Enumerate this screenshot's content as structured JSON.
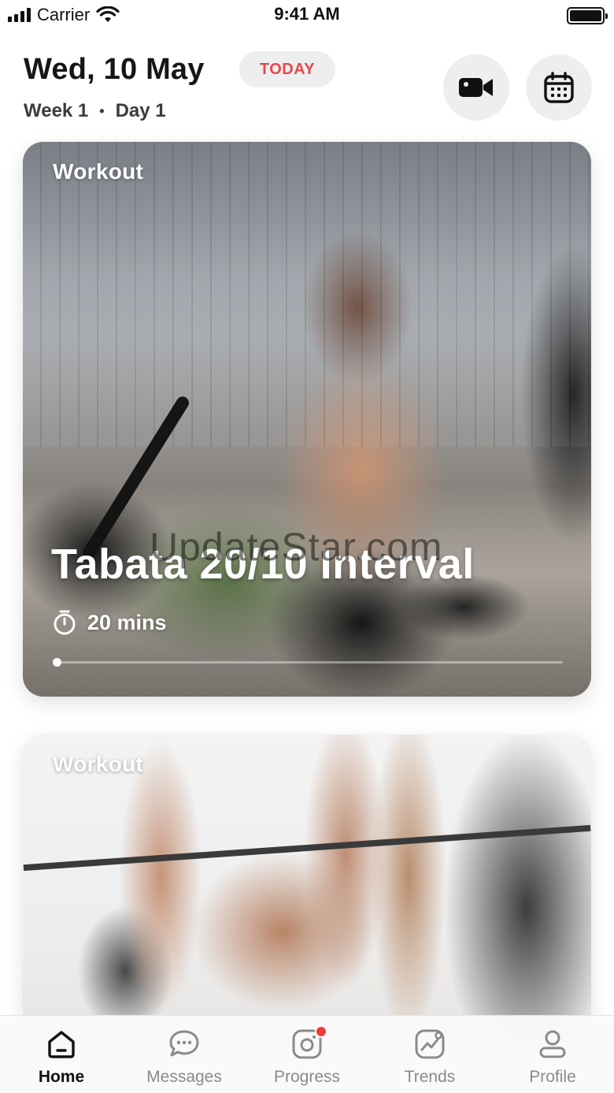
{
  "status_bar": {
    "carrier": "Carrier",
    "time": "9:41 AM"
  },
  "header": {
    "date": "Wed, 10 May",
    "today_badge": "TODAY",
    "week": "Week 1",
    "day": "Day 1",
    "separator": "•",
    "video_icon": "video-camera-icon",
    "calendar_icon": "calendar-icon"
  },
  "cards": [
    {
      "tag": "Workout",
      "title": "Tabata 20/10 Interval",
      "duration": "20 mins",
      "duration_icon": "stopwatch-icon",
      "progress": 0.0
    },
    {
      "tag": "Workout"
    }
  ],
  "watermark": "UpdateStar.com",
  "tab_bar": {
    "items": [
      {
        "label": "Home",
        "icon": "home-icon",
        "active": true
      },
      {
        "label": "Messages",
        "icon": "chat-bubble-icon",
        "active": false
      },
      {
        "label": "Progress",
        "icon": "camera-icon",
        "active": false,
        "badge": true
      },
      {
        "label": "Trends",
        "icon": "trends-chart-icon",
        "active": false
      },
      {
        "label": "Profile",
        "icon": "user-icon",
        "active": false
      }
    ]
  },
  "colors": {
    "today_text": "#e34a4a",
    "button_bg": "#eeeeee",
    "badge_red": "#ee3b3b",
    "inactive_tab": "#8a8a8a"
  }
}
